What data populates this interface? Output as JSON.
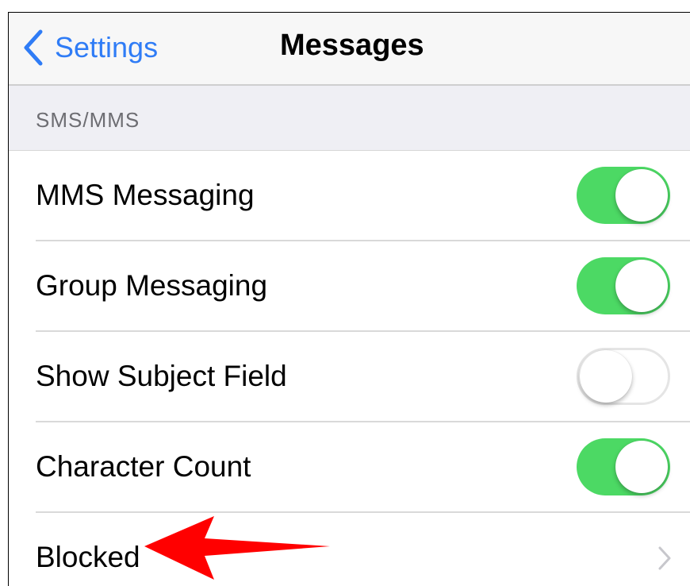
{
  "nav": {
    "back_label": "Settings",
    "title": "Messages"
  },
  "section": {
    "label": "SMS/MMS"
  },
  "rows": [
    {
      "label": "MMS Messaging",
      "control": "toggle",
      "on": true
    },
    {
      "label": "Group Messaging",
      "control": "toggle",
      "on": true
    },
    {
      "label": "Show Subject Field",
      "control": "toggle",
      "on": false
    },
    {
      "label": "Character Count",
      "control": "toggle",
      "on": true
    },
    {
      "label": "Blocked",
      "control": "disclosure"
    }
  ],
  "colors": {
    "accent_blue": "#2f7cf6",
    "toggle_on_green": "#4cd964",
    "annotation_arrow_red": "#ff0000"
  },
  "icons": {
    "back": "chevron-left-icon",
    "disclosure": "chevron-right-icon",
    "annotation": "red-arrow-icon"
  }
}
